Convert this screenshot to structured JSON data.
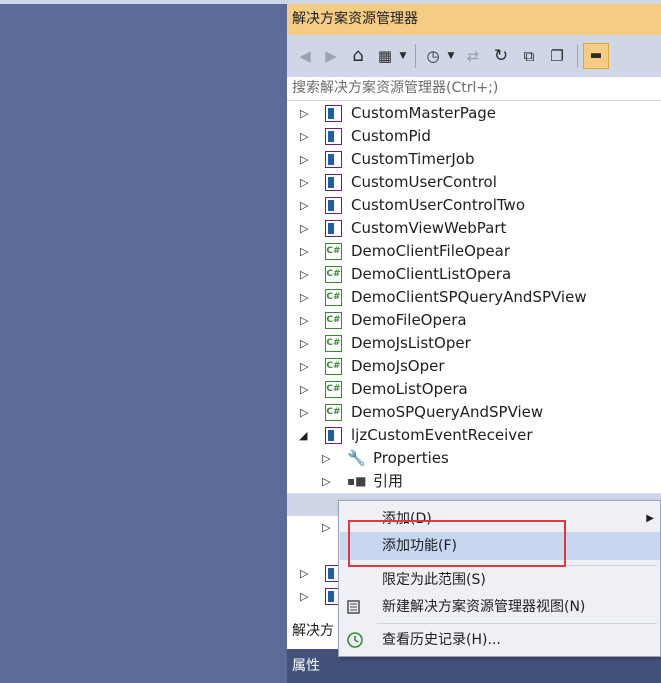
{
  "panel": {
    "title": "解决方案资源管理器",
    "search_placeholder": "搜索解决方案资源管理器(Ctrl+;)",
    "bottom_tab": "解决方",
    "properties_title": "属性"
  },
  "colors": {
    "background": "#5d6b99",
    "title_bar": "#f5cc84",
    "toolbar": "#cfd6e5",
    "properties_bar": "#42527a",
    "highlight_box": "#e0383c",
    "menu_highlight": "#c9d6ef"
  },
  "toolbar": {
    "icons": [
      "back-icon",
      "forward-icon",
      "home-icon",
      "switch-views-icon",
      "dropdown-icon",
      "pending-changes-icon",
      "dropdown-icon",
      "sync-icon",
      "refresh-icon",
      "collapse-all-icon",
      "show-all-files-icon",
      "properties-icon"
    ]
  },
  "tree": [
    {
      "label": "CustomMasterPage",
      "type": "project",
      "expanded": false
    },
    {
      "label": "CustomPid",
      "type": "project",
      "expanded": false
    },
    {
      "label": "CustomTimerJob",
      "type": "project",
      "expanded": false
    },
    {
      "label": "CustomUserControl",
      "type": "project",
      "expanded": false
    },
    {
      "label": "CustomUserControlTwo",
      "type": "project",
      "expanded": false
    },
    {
      "label": "CustomViewWebPart",
      "type": "project",
      "expanded": false
    },
    {
      "label": "DemoClientFileOpear",
      "type": "csharp",
      "expanded": false
    },
    {
      "label": "DemoClientListOpera",
      "type": "csharp",
      "expanded": false
    },
    {
      "label": "DemoClientSPQueryAndSPView",
      "type": "csharp",
      "expanded": false
    },
    {
      "label": "DemoFileOpera",
      "type": "csharp",
      "expanded": false
    },
    {
      "label": "DemoJsListOper",
      "type": "csharp",
      "expanded": false
    },
    {
      "label": "DemoJsOper",
      "type": "csharp",
      "expanded": false
    },
    {
      "label": "DemoListOpera",
      "type": "csharp",
      "expanded": false
    },
    {
      "label": "DemoSPQueryAndSPView",
      "type": "csharp",
      "expanded": false
    },
    {
      "label": "ljzCustomEventReceiver",
      "type": "project",
      "expanded": true
    },
    {
      "label": "Properties",
      "type": "properties",
      "expanded": false
    },
    {
      "label": "引用",
      "type": "references",
      "expanded": false
    }
  ],
  "context_menu": {
    "items": [
      {
        "label": "添加(D)",
        "submenu": true
      },
      {
        "label": "添加功能(F)",
        "highlighted": true
      },
      {
        "label": "限定为此范围(S)"
      },
      {
        "label": "新建解决方案资源管理器视图(N)"
      },
      {
        "label": "查看历史记录(H)..."
      }
    ]
  }
}
